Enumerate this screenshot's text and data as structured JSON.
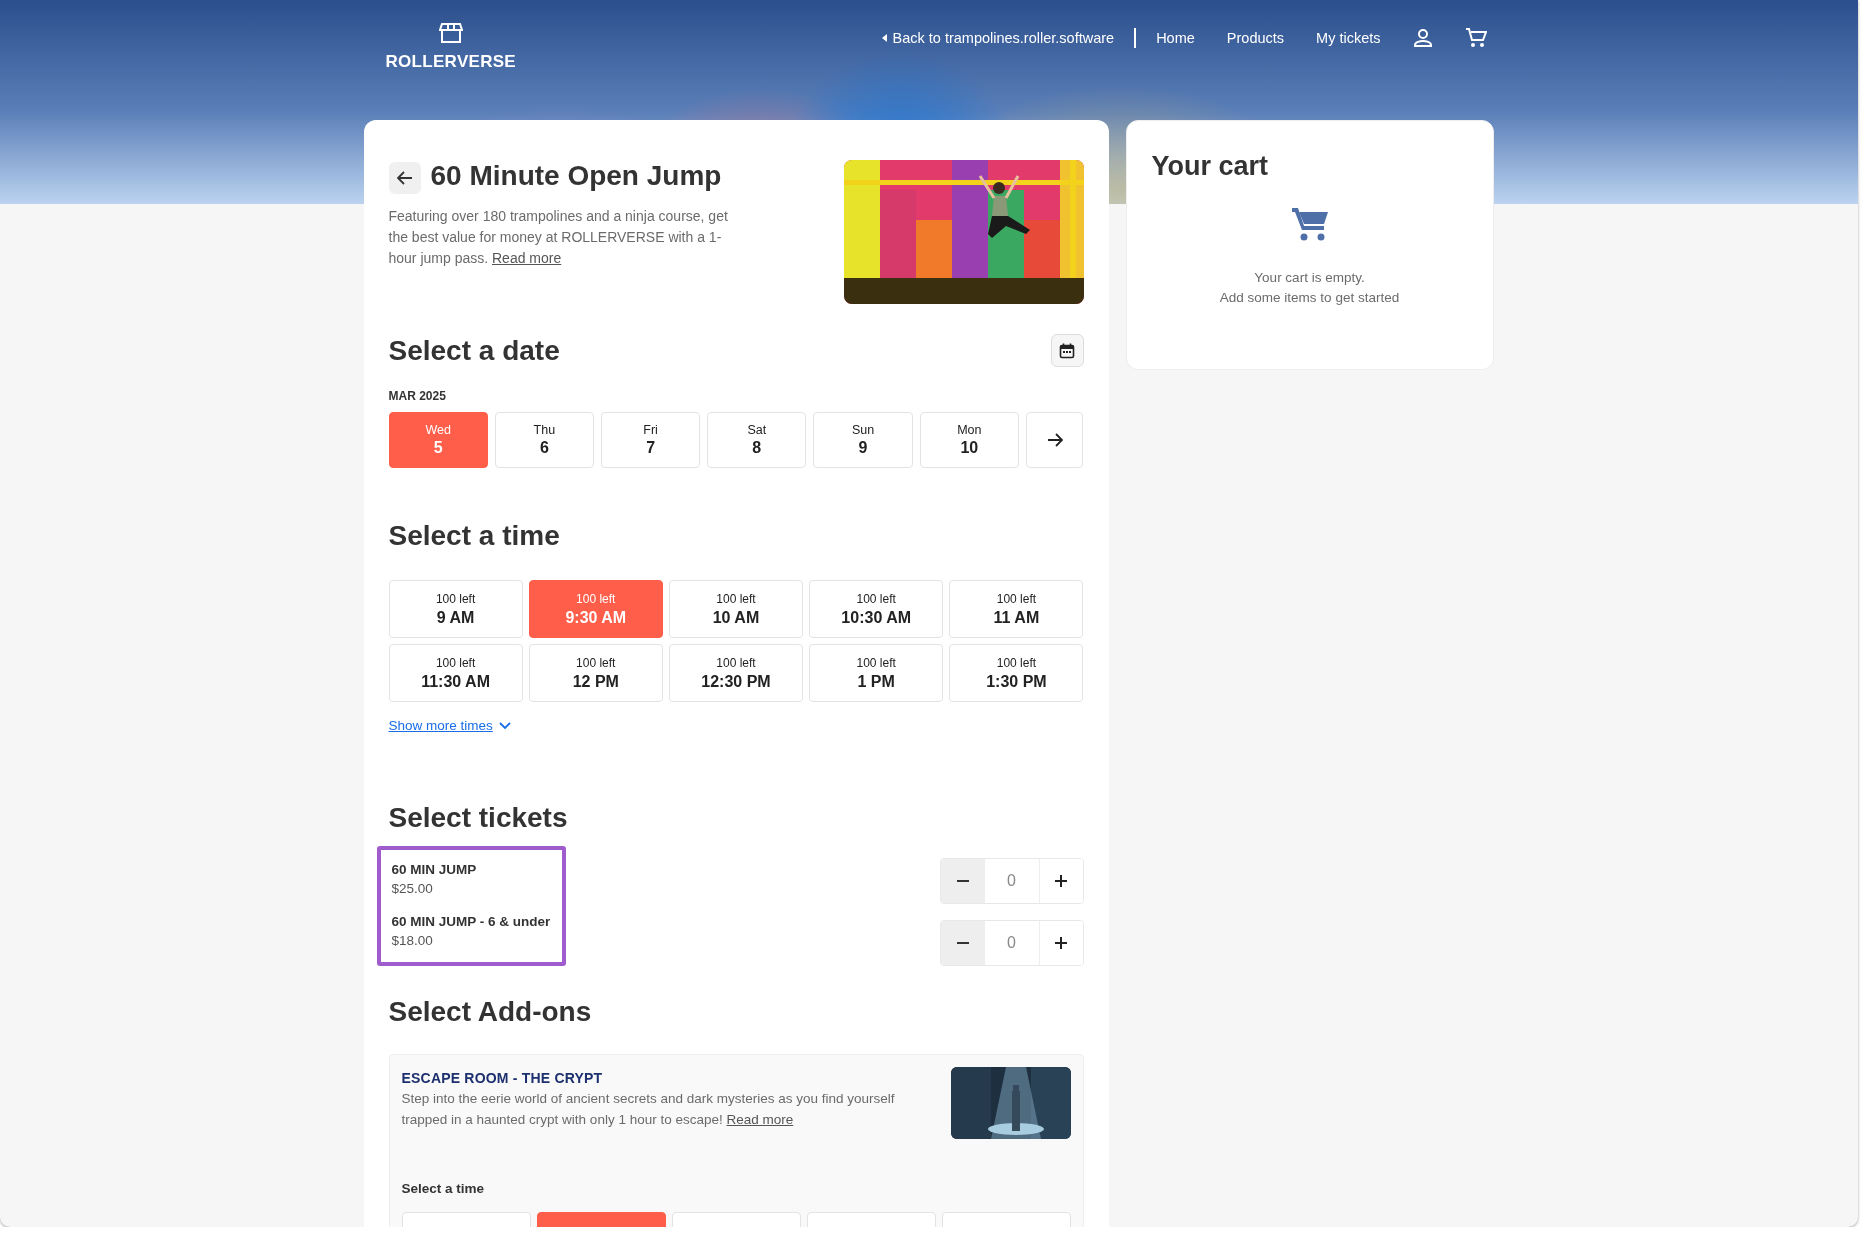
{
  "header": {
    "brand": "ROLLERVERSE",
    "back_link": "Back to trampolines.roller.software",
    "nav": [
      "Home",
      "Products",
      "My tickets"
    ]
  },
  "product": {
    "title": "60 Minute Open Jump",
    "description": "Featuring over 180 trampolines and a ninja course, get the best value for money at ROLLERVERSE with a 1-hour jump pass.",
    "read_more": "Read more",
    "image": {
      "kind": "picture"
    }
  },
  "date_section": {
    "heading": "Select a date",
    "month": "MAR 2025",
    "dates": [
      {
        "weekday": "Wed",
        "day": "5",
        "selected": true
      },
      {
        "weekday": "Thu",
        "day": "6",
        "selected": false
      },
      {
        "weekday": "Fri",
        "day": "7",
        "selected": false
      },
      {
        "weekday": "Sat",
        "day": "8",
        "selected": false
      },
      {
        "weekday": "Sun",
        "day": "9",
        "selected": false
      },
      {
        "weekday": "Mon",
        "day": "10",
        "selected": false
      }
    ]
  },
  "time_section": {
    "heading": "Select a time",
    "slots": [
      {
        "availability": "100 left",
        "time": "9 AM",
        "selected": false
      },
      {
        "availability": "100 left",
        "time": "9:30 AM",
        "selected": true
      },
      {
        "availability": "100 left",
        "time": "10 AM",
        "selected": false
      },
      {
        "availability": "100 left",
        "time": "10:30 AM",
        "selected": false
      },
      {
        "availability": "100 left",
        "time": "11 AM",
        "selected": false
      },
      {
        "availability": "100 left",
        "time": "11:30 AM",
        "selected": false
      },
      {
        "availability": "100 left",
        "time": "12 PM",
        "selected": false
      },
      {
        "availability": "100 left",
        "time": "12:30 PM",
        "selected": false
      },
      {
        "availability": "100 left",
        "time": "1 PM",
        "selected": false
      },
      {
        "availability": "100 left",
        "time": "1:30 PM",
        "selected": false
      }
    ],
    "show_more": "Show more times"
  },
  "tickets_section": {
    "heading": "Select tickets",
    "highlighted": true,
    "tickets": [
      {
        "name": "60 MIN JUMP",
        "price": "$25.00",
        "quantity": "0"
      },
      {
        "name": "60 MIN JUMP - 6 & under",
        "price": "$18.00",
        "quantity": "0"
      }
    ]
  },
  "addons_section": {
    "heading": "Select Add-ons",
    "addons": [
      {
        "title": "ESCAPE ROOM - THE CRYPT",
        "description": "Step into the eerie world of ancient secrets and dark mysteries as you find yourself trapped in a haunted crypt with only 1 hour to escape!",
        "read_more": "Read more",
        "image": {
          "kind": "picture"
        },
        "time_heading": "Select a time",
        "slots": [
          {
            "selected": false
          },
          {
            "selected": true
          },
          {
            "selected": false
          },
          {
            "selected": false
          },
          {
            "selected": false
          }
        ]
      }
    ]
  },
  "cart": {
    "title": "Your cart",
    "empty_message": "Your cart is empty.",
    "empty_hint": "Add some items to get started"
  }
}
